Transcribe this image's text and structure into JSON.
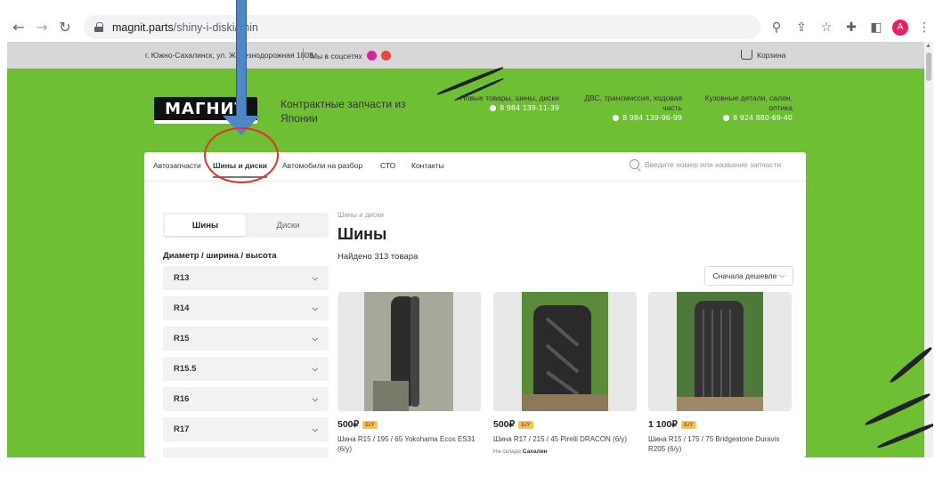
{
  "browser": {
    "url_domain": "magnit.parts",
    "url_path": "/shiny-i-diski/shin",
    "profile_initial": "A"
  },
  "topbar": {
    "address": "г. Южно-Сахалинск, ул. Железнодорожная 180Б",
    "social": "Мы в соцсетях",
    "cart": "Корзина"
  },
  "header": {
    "logo": "МАГНИТ",
    "tagline": "Контрактные запчасти из Японии",
    "contacts": [
      {
        "label": "Новые товары, шины, диски",
        "phone": "8 984 139-11-39"
      },
      {
        "label": "ДВС, трансмиссия, ходовая часть",
        "phone": "8 984 139-96-99"
      },
      {
        "label": "Кузовные детали, салон, оптика",
        "phone": "8 924 880-69-40"
      }
    ]
  },
  "menu": {
    "items": [
      "Автозапчасти",
      "Шины и диски",
      "Автомобили на разбор",
      "СТО",
      "Контакты"
    ],
    "search_placeholder": "Введите номер или название запчасти"
  },
  "sidebar": {
    "tabs": [
      "Шины",
      "Диски"
    ],
    "filter_title": "Диаметр / ширина / высота",
    "sizes": [
      "R13",
      "R14",
      "R15",
      "R15.5",
      "R16",
      "R17"
    ]
  },
  "content": {
    "breadcrumb": "Шины и диски",
    "title": "Шины",
    "found": "Найдено 313 товара",
    "sort": "Сначала дешевле"
  },
  "products": [
    {
      "price": "500₽",
      "badge": "Б/У",
      "name": "Шина R15 / 195 / 65 Yokohama Ecos ES31 (6/у)",
      "stock_label": "",
      "stock_value": ""
    },
    {
      "price": "500₽",
      "badge": "Б/У",
      "name": "Шина R17 / 215 / 45 Pirelli DRACON (6/у)",
      "stock_label": "На складе",
      "stock_value": "Сахалин"
    },
    {
      "price": "1 100₽",
      "badge": "Б/У",
      "name": "Шина R15 / 175 / 75 Bridgestone Duravis R205 (6/у)",
      "stock_label": "",
      "stock_value": ""
    }
  ],
  "colors": {
    "site_green": "#6fbf34",
    "annotation_arrow": "#4e86c6",
    "annotation_circle": "#e53030",
    "badge": "#f5c842"
  }
}
